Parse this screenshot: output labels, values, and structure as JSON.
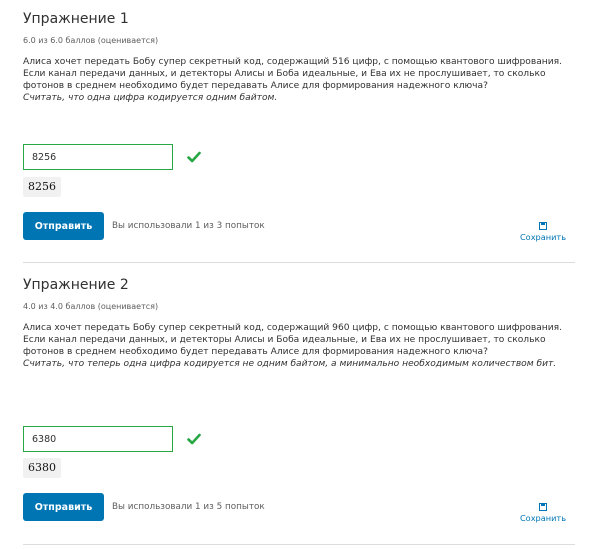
{
  "problems": [
    {
      "title": "Упражнение 1",
      "progress": "6.0 из 6.0 баллов (оценивается)",
      "text": "Алиса хочет передать Бобу супер секретный код, содержащий 516 цифр, с помощью квантового шифрования. Если канал передачи данных, и детекторы Алисы и Боба идеальные, и Ева их не прослушивает, то сколько фотонов в среднем необходимо будет передавать Алисе для формирования надежного ключа?",
      "note": "Считать, что одна цифра кодируется одним байтом.",
      "answer_value": "8256",
      "math_preview": "8256",
      "status": "correct",
      "submit_label": "Отправить",
      "attempts": "Вы использовали 1 из 3 попыток",
      "save_label": "Сохранить"
    },
    {
      "title": "Упражнение 2",
      "progress": "4.0 из 4.0 баллов (оценивается)",
      "text": "Алиса хочет передать Бобу супер секретный код, содержащий 960 цифр, с помощью квантового шифрования. Если канал передачи данных, и детекторы Алисы и Боба идеальные, и Ева их не прослушивает, то сколько фотонов в среднем необходимо будет передавать Алисе для формирования надежного ключа?",
      "note": "Считать, что теперь одна цифра кодируется не одним байтом, а минимально необходимым количеством бит.",
      "answer_value": "6380",
      "math_preview": "6380",
      "status": "correct",
      "submit_label": "Отправить",
      "attempts": "Вы использовали 1 из 5 попыток",
      "save_label": "Сохранить"
    }
  ],
  "colors": {
    "accent": "#0075b4",
    "correct": "#28a745"
  },
  "icons": {
    "status": "checkmark-icon",
    "save": "save-icon"
  }
}
